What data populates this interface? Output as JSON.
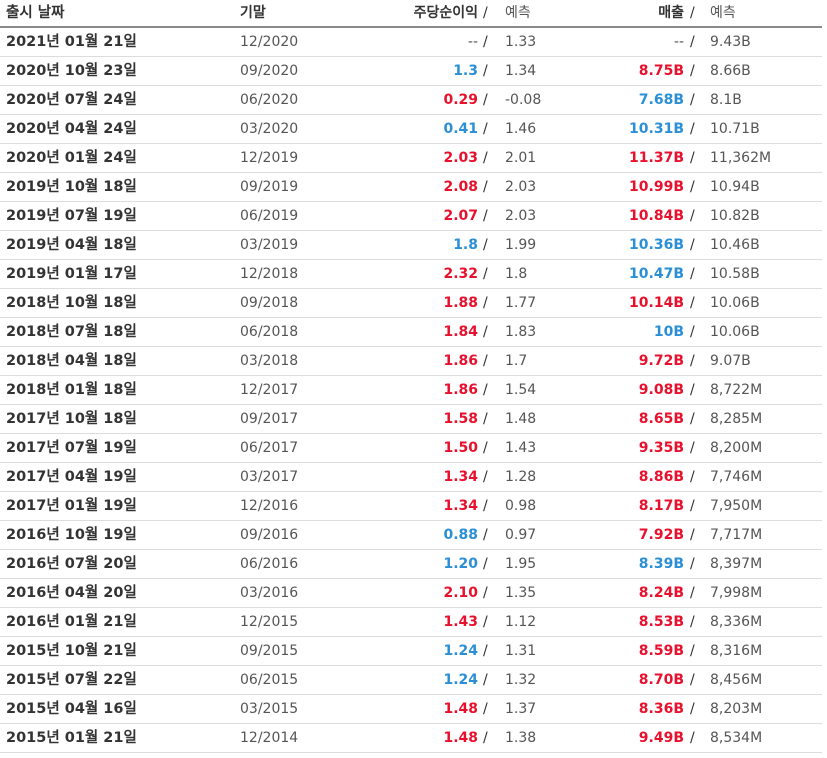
{
  "header": {
    "date": "출시 날짜",
    "period": "기말",
    "eps": "주당순이익",
    "slash": "/",
    "eps_forecast": "예측",
    "revenue": "매출",
    "revenue_forecast": "예측"
  },
  "colors": {
    "beat": "#e8112d",
    "miss": "#2b8fd6",
    "none": "#555555"
  },
  "rows": [
    {
      "date": "2021년 01월 21일",
      "period": "12/2020",
      "eps": "--",
      "eps_color": "none",
      "eps_forecast": "1.33",
      "revenue": "--",
      "revenue_color": "none",
      "revenue_forecast": "9.43B"
    },
    {
      "date": "2020년 10월 23일",
      "period": "09/2020",
      "eps": "1.3",
      "eps_color": "miss",
      "eps_forecast": "1.34",
      "revenue": "8.75B",
      "revenue_color": "beat",
      "revenue_forecast": "8.66B"
    },
    {
      "date": "2020년 07월 24일",
      "period": "06/2020",
      "eps": "0.29",
      "eps_color": "beat",
      "eps_forecast": "-0.08",
      "revenue": "7.68B",
      "revenue_color": "miss",
      "revenue_forecast": "8.1B"
    },
    {
      "date": "2020년 04월 24일",
      "period": "03/2020",
      "eps": "0.41",
      "eps_color": "miss",
      "eps_forecast": "1.46",
      "revenue": "10.31B",
      "revenue_color": "miss",
      "revenue_forecast": "10.71B"
    },
    {
      "date": "2020년 01월 24일",
      "period": "12/2019",
      "eps": "2.03",
      "eps_color": "beat",
      "eps_forecast": "2.01",
      "revenue": "11.37B",
      "revenue_color": "beat",
      "revenue_forecast": "11,362M"
    },
    {
      "date": "2019년 10월 18일",
      "period": "09/2019",
      "eps": "2.08",
      "eps_color": "beat",
      "eps_forecast": "2.03",
      "revenue": "10.99B",
      "revenue_color": "beat",
      "revenue_forecast": "10.94B"
    },
    {
      "date": "2019년 07월 19일",
      "period": "06/2019",
      "eps": "2.07",
      "eps_color": "beat",
      "eps_forecast": "2.03",
      "revenue": "10.84B",
      "revenue_color": "beat",
      "revenue_forecast": "10.82B"
    },
    {
      "date": "2019년 04월 18일",
      "period": "03/2019",
      "eps": "1.8",
      "eps_color": "miss",
      "eps_forecast": "1.99",
      "revenue": "10.36B",
      "revenue_color": "miss",
      "revenue_forecast": "10.46B"
    },
    {
      "date": "2019년 01월 17일",
      "period": "12/2018",
      "eps": "2.32",
      "eps_color": "beat",
      "eps_forecast": "1.8",
      "revenue": "10.47B",
      "revenue_color": "miss",
      "revenue_forecast": "10.58B"
    },
    {
      "date": "2018년 10월 18일",
      "period": "09/2018",
      "eps": "1.88",
      "eps_color": "beat",
      "eps_forecast": "1.77",
      "revenue": "10.14B",
      "revenue_color": "beat",
      "revenue_forecast": "10.06B"
    },
    {
      "date": "2018년 07월 18일",
      "period": "06/2018",
      "eps": "1.84",
      "eps_color": "beat",
      "eps_forecast": "1.83",
      "revenue": "10B",
      "revenue_color": "miss",
      "revenue_forecast": "10.06B"
    },
    {
      "date": "2018년 04월 18일",
      "period": "03/2018",
      "eps": "1.86",
      "eps_color": "beat",
      "eps_forecast": "1.7",
      "revenue": "9.72B",
      "revenue_color": "beat",
      "revenue_forecast": "9.07B"
    },
    {
      "date": "2018년 01월 18일",
      "period": "12/2017",
      "eps": "1.86",
      "eps_color": "beat",
      "eps_forecast": "1.54",
      "revenue": "9.08B",
      "revenue_color": "beat",
      "revenue_forecast": "8,722M"
    },
    {
      "date": "2017년 10월 18일",
      "period": "09/2017",
      "eps": "1.58",
      "eps_color": "beat",
      "eps_forecast": "1.48",
      "revenue": "8.65B",
      "revenue_color": "beat",
      "revenue_forecast": "8,285M"
    },
    {
      "date": "2017년 07월 19일",
      "period": "06/2017",
      "eps": "1.50",
      "eps_color": "beat",
      "eps_forecast": "1.43",
      "revenue": "9.35B",
      "revenue_color": "beat",
      "revenue_forecast": "8,200M"
    },
    {
      "date": "2017년 04월 19일",
      "period": "03/2017",
      "eps": "1.34",
      "eps_color": "beat",
      "eps_forecast": "1.28",
      "revenue": "8.86B",
      "revenue_color": "beat",
      "revenue_forecast": "7,746M"
    },
    {
      "date": "2017년 01월 19일",
      "period": "12/2016",
      "eps": "1.34",
      "eps_color": "beat",
      "eps_forecast": "0.98",
      "revenue": "8.17B",
      "revenue_color": "beat",
      "revenue_forecast": "7,950M"
    },
    {
      "date": "2016년 10월 19일",
      "period": "09/2016",
      "eps": "0.88",
      "eps_color": "miss",
      "eps_forecast": "0.97",
      "revenue": "7.92B",
      "revenue_color": "beat",
      "revenue_forecast": "7,717M"
    },
    {
      "date": "2016년 07월 20일",
      "period": "06/2016",
      "eps": "1.20",
      "eps_color": "miss",
      "eps_forecast": "1.95",
      "revenue": "8.39B",
      "revenue_color": "miss",
      "revenue_forecast": "8,397M"
    },
    {
      "date": "2016년 04월 20일",
      "period": "03/2016",
      "eps": "2.10",
      "eps_color": "beat",
      "eps_forecast": "1.35",
      "revenue": "8.24B",
      "revenue_color": "beat",
      "revenue_forecast": "7,998M"
    },
    {
      "date": "2016년 01월 21일",
      "period": "12/2015",
      "eps": "1.43",
      "eps_color": "beat",
      "eps_forecast": "1.12",
      "revenue": "8.53B",
      "revenue_color": "beat",
      "revenue_forecast": "8,336M"
    },
    {
      "date": "2015년 10월 21일",
      "period": "09/2015",
      "eps": "1.24",
      "eps_color": "miss",
      "eps_forecast": "1.31",
      "revenue": "8.59B",
      "revenue_color": "beat",
      "revenue_forecast": "8,316M"
    },
    {
      "date": "2015년 07월 22일",
      "period": "06/2015",
      "eps": "1.24",
      "eps_color": "miss",
      "eps_forecast": "1.32",
      "revenue": "8.70B",
      "revenue_color": "beat",
      "revenue_forecast": "8,456M"
    },
    {
      "date": "2015년 04월 16일",
      "period": "03/2015",
      "eps": "1.48",
      "eps_color": "beat",
      "eps_forecast": "1.37",
      "revenue": "8.36B",
      "revenue_color": "beat",
      "revenue_forecast": "8,203M"
    },
    {
      "date": "2015년 01월 21일",
      "period": "12/2014",
      "eps": "1.48",
      "eps_color": "beat",
      "eps_forecast": "1.38",
      "revenue": "9.49B",
      "revenue_color": "beat",
      "revenue_forecast": "8,534M"
    }
  ]
}
